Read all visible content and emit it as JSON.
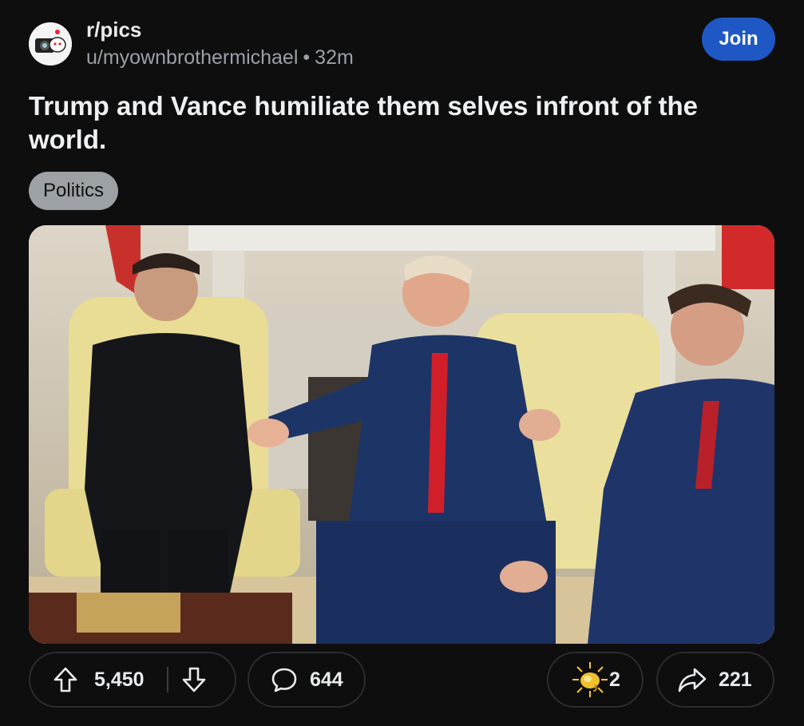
{
  "post": {
    "subreddit": "r/pics",
    "author": "u/myownbrothermichael",
    "separator": "•",
    "time": "32m",
    "join_label": "Join",
    "title": "Trump and Vance humiliate them selves infront of the world.",
    "flair": "Politics"
  },
  "actions": {
    "upvotes": "5,450",
    "comments": "644",
    "awards": "2",
    "shares": "221"
  },
  "icons": {
    "upvote": "arrow-up-icon",
    "downvote": "arrow-down-icon",
    "comment": "comment-bubble-icon",
    "award": "award-icon",
    "share": "share-arrow-icon"
  },
  "colors": {
    "background": "#0e0e0f",
    "join_button": "#1f58c4",
    "flair_bg": "#9ca1a5"
  }
}
